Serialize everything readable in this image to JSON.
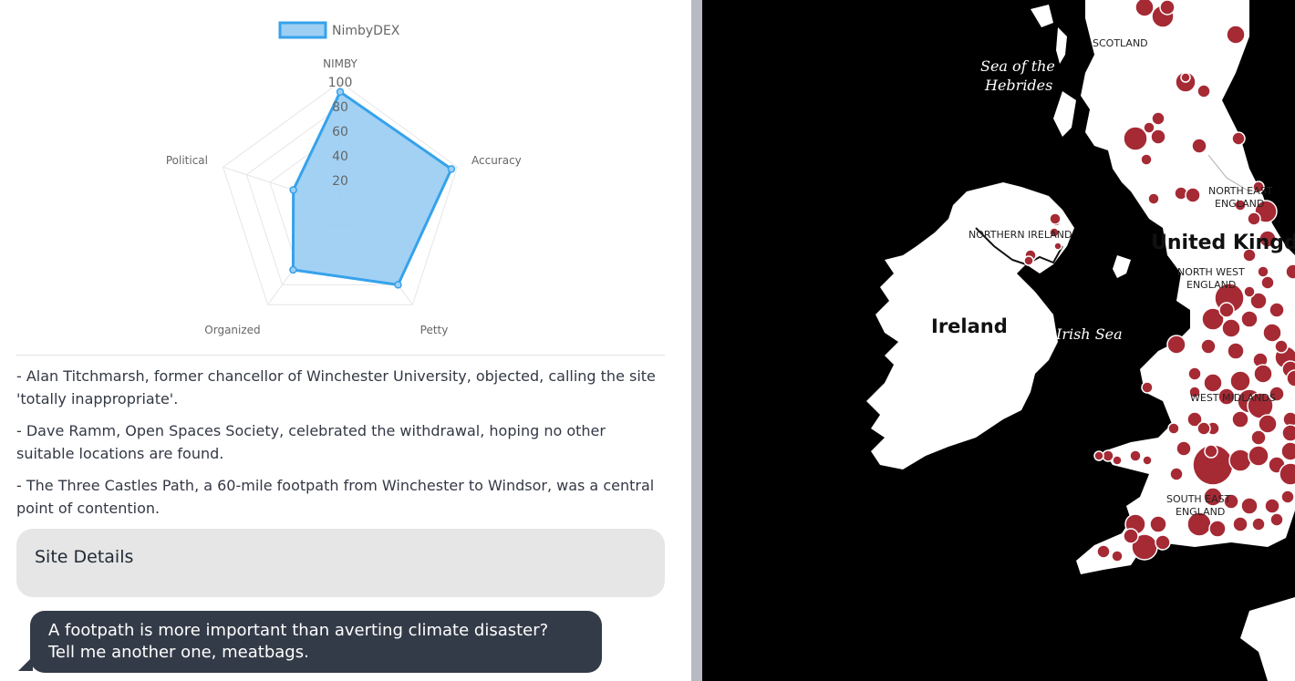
{
  "radar": {
    "legend_label": "NimbyDEX",
    "axes": [
      "NIMBY",
      "Accuracy",
      "Petty",
      "Organized",
      "Political"
    ],
    "ticks": [
      "20",
      "40",
      "60",
      "80",
      "100"
    ],
    "max": 100
  },
  "chart_data": {
    "type": "radar",
    "categories": [
      "NIMBY",
      "Accuracy",
      "Petty",
      "Organized",
      "Political"
    ],
    "series": [
      {
        "name": "NimbyDEX",
        "values": [
          92,
          95,
          80,
          65,
          40
        ]
      }
    ],
    "rlim": [
      0,
      100
    ],
    "ticks": [
      20,
      40,
      60,
      80,
      100
    ],
    "legend_position": "top",
    "colors": {
      "stroke": "#36a2eb",
      "fill": "#9dcff3"
    }
  },
  "notes": [
    "- Alan Titchmarsh, former chancellor of Winchester University, objected, calling the site 'totally inappropriate'.",
    "- Dave Ramm, Open Spaces Society, celebrated the withdrawal, hoping no other suitable locations are found.",
    "- The Three Castles Path, a 60-mile footpath from Winchester to Windsor, was a central point of contention."
  ],
  "site_details": {
    "label": "Site Details"
  },
  "bubble": {
    "lines": [
      "A footpath is more important than averting climate disaster?",
      "Tell me another one, meatbags."
    ]
  },
  "map": {
    "labels": {
      "sea_hebrides_1": "Sea of the",
      "sea_hebrides_2": "Hebrides",
      "scotland": "SCOTLAND",
      "north_east_1": "NORTH EAST",
      "north_east_2": "ENGLAND",
      "northern_ireland": "NORTHERN IRELAND",
      "uk": "United Kingdom",
      "north_west_1": "NORTH WEST",
      "north_west_2": "ENGLAND",
      "ireland": "Ireland",
      "irish_sea": "Irish Sea",
      "west": "WEST MIDLANDS",
      "south_east_1": "SOUTH EAST",
      "south_east_2": "ENGLAND"
    },
    "colors": {
      "marker": "#a52a34",
      "land": "#ffffff",
      "sea": "#000000"
    }
  }
}
